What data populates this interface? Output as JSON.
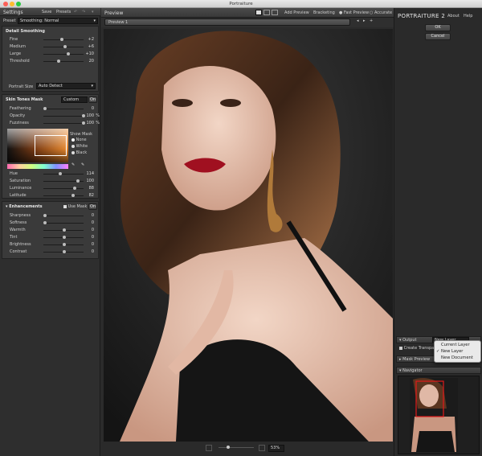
{
  "window": {
    "title": "Portraiture"
  },
  "settings": {
    "title": "Settings",
    "save": "Save",
    "presets": "Presets",
    "preset_label": "Preset",
    "preset_value": "Smoothing: Normal"
  },
  "detail": {
    "title": "Detail Smoothing",
    "rows": [
      {
        "label": "Fine",
        "value": "+2"
      },
      {
        "label": "Medium",
        "value": "+6"
      },
      {
        "label": "Large",
        "value": "+10"
      },
      {
        "label": "Threshold",
        "value": "20"
      }
    ],
    "portrait_size_label": "Portrait Size",
    "portrait_size_value": "Auto Detect"
  },
  "skin": {
    "title": "Skin Tones Mask",
    "mode": "Custom",
    "toggle": "On",
    "rows": [
      {
        "label": "Feathering",
        "value": "0",
        "unit": ""
      },
      {
        "label": "Opacity",
        "value": "100",
        "unit": "%"
      },
      {
        "label": "Fuzziness",
        "value": "100",
        "unit": "%"
      }
    ],
    "show_mask_label": "Show Mask",
    "options": [
      "None",
      "White",
      "Black"
    ],
    "hsl_rows": [
      {
        "label": "Hue",
        "value": "114"
      },
      {
        "label": "Saturation",
        "value": "100"
      },
      {
        "label": "Luminance",
        "value": "88"
      },
      {
        "label": "Latitude",
        "value": "82"
      }
    ]
  },
  "enh": {
    "title": "Enhancements",
    "use_mask": "Use Mask",
    "toggle": "On",
    "rows": [
      {
        "label": "Sharpness",
        "value": "0"
      },
      {
        "label": "Softness",
        "value": "0"
      },
      {
        "label": "Warmth",
        "value": "0"
      },
      {
        "label": "Tint",
        "value": "0"
      },
      {
        "label": "Brightness",
        "value": "0"
      },
      {
        "label": "Contrast",
        "value": "0"
      }
    ]
  },
  "preview": {
    "title": "Preview",
    "add_preview": "Add Preview",
    "bracketing": "Bracketing",
    "fast": "Fast Preview",
    "accurate": "Accurate",
    "tab": "Preview 1",
    "zoom": "53%"
  },
  "brand": {
    "name": "PORTRAITURE",
    "version": "2",
    "about": "About",
    "help": "Help",
    "ok": "OK",
    "cancel": "Cancel"
  },
  "output": {
    "label": "Output",
    "value": "New Layer",
    "create_transparent": "Create Transpa",
    "mask_preview": "Mask Preview",
    "navigator": "Navigator"
  },
  "dropdown": {
    "items": [
      "Current Layer",
      "New Layer",
      "New Document"
    ],
    "checked_index": 1
  }
}
